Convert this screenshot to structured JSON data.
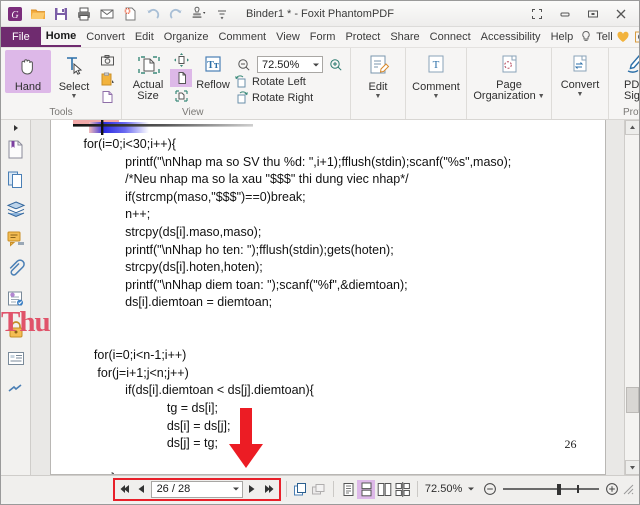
{
  "window": {
    "title": "Binder1 * - Foxit PhantomPDF",
    "quick_access": [
      {
        "name": "foxit-logo-icon",
        "label": "Foxit"
      },
      {
        "name": "open-folder-icon",
        "label": "Open"
      },
      {
        "name": "save-icon",
        "label": "Save"
      },
      {
        "name": "print-icon",
        "label": "Print"
      },
      {
        "name": "email-icon",
        "label": "Email"
      },
      {
        "name": "new-from-file-icon",
        "label": "Create PDF"
      },
      {
        "name": "undo-icon",
        "label": "Undo"
      },
      {
        "name": "redo-icon",
        "label": "Redo"
      },
      {
        "name": "stamp-icon",
        "label": "Stamp"
      },
      {
        "name": "customize-toolbar-icon",
        "label": "Customize"
      }
    ],
    "controls": [
      {
        "name": "fullscreen-button",
        "label": "Fullscreen"
      },
      {
        "name": "minimize-button",
        "label": "Minimize"
      },
      {
        "name": "restore-button",
        "label": "Restore"
      },
      {
        "name": "close-button",
        "label": "Close"
      }
    ]
  },
  "menubar": {
    "file": "File",
    "items": [
      {
        "label": "Home",
        "active": true
      },
      {
        "label": "Convert",
        "active": false
      },
      {
        "label": "Edit",
        "active": false
      },
      {
        "label": "Organize",
        "active": false
      },
      {
        "label": "Comment",
        "active": false
      },
      {
        "label": "View",
        "active": false
      },
      {
        "label": "Form",
        "active": false
      },
      {
        "label": "Protect",
        "active": false
      },
      {
        "label": "Share",
        "active": false
      },
      {
        "label": "Connect",
        "active": false
      },
      {
        "label": "Accessibility",
        "active": false
      },
      {
        "label": "Help",
        "active": false
      }
    ],
    "tell_label": "Tell",
    "find_label": "Fi"
  },
  "ribbon": {
    "groups": [
      {
        "label": "Tools",
        "buttons": [
          {
            "name": "hand-tool-button",
            "label": "Hand",
            "selected": true
          },
          {
            "name": "select-tool-button",
            "label": "Select",
            "selected": false
          }
        ],
        "small_icons": [
          {
            "name": "snapshot-icon",
            "label": "Snapshot"
          },
          {
            "name": "clipboard-icon",
            "label": "Clipboard"
          },
          {
            "name": "select-page-icon",
            "label": "Select Annotation"
          }
        ]
      },
      {
        "label": "View",
        "buttons": [
          {
            "name": "actual-size-button",
            "label": "Actual",
            "label2": "Size"
          },
          {
            "name": "fit-page-button",
            "label": "Fit Page"
          },
          {
            "name": "reflow-button",
            "label": "Reflow"
          }
        ],
        "zoom_value": "72.50%",
        "rotate_left": "Rotate Left",
        "rotate_right": "Rotate Right"
      }
    ],
    "command_buttons": [
      {
        "name": "edit-button",
        "label": "Edit",
        "has_caret": true
      },
      {
        "name": "comment-button",
        "label": "Comment",
        "has_caret": true
      },
      {
        "name": "page-organization-button",
        "label": "Page",
        "label2": "Organization",
        "has_caret": true
      },
      {
        "name": "convert-button",
        "label": "Convert",
        "has_caret": true
      },
      {
        "name": "pdf-sign-button",
        "label": "PDF",
        "label2": "Sign",
        "has_caret": false
      }
    ],
    "protect_label": "Protect",
    "collapse_label": "∧"
  },
  "navpane": {
    "items": [
      {
        "name": "sidebar-item-bookmarks",
        "label": "Bookmarks"
      },
      {
        "name": "sidebar-item-pages",
        "label": "Page Thumbnails"
      },
      {
        "name": "sidebar-item-layers",
        "label": "Layers"
      },
      {
        "name": "sidebar-item-comments",
        "label": "Comments"
      },
      {
        "name": "sidebar-item-attachments",
        "label": "Attachments"
      },
      {
        "name": "sidebar-item-signatures",
        "label": "Digital Signatures"
      },
      {
        "name": "sidebar-item-security",
        "label": "Security"
      },
      {
        "name": "sidebar-item-fields",
        "label": "Fields"
      },
      {
        "name": "sidebar-item-stamps",
        "label": "Stamps"
      }
    ]
  },
  "watermark": "Thu",
  "document": {
    "page_label": "26",
    "code": "for(i=0;i<30;i++){\n            printf(\"\\nNhap ma so SV thu %d: \",i+1);fflush(stdin);scanf(\"%s\",maso);\n            /*Neu nhap ma so la xau \"$$$\" thi dung viec nhap*/\n            if(strcmp(maso,\"$$$\")==0)break;\n            n++;\n            strcpy(ds[i].maso,maso);\n            printf(\"\\nNhap ho ten: \");fflush(stdin);gets(hoten);\n            strcpy(ds[i].hoten,hoten);\n            printf(\"\\nNhap diem toan: \");scanf(\"%f\",&diemtoan);\n            ds[i].diemtoan = diemtoan;\n\n\n   for(i=0;i<n-1;i++)\n    for(j=i+1;j<n;j++)\n            if(ds[i].diemtoan < ds[j].diemtoan){\n                        tg = ds[i];\n                        ds[i] = ds[j];\n                        ds[j] = tg;\n\n        }"
  },
  "statusbar": {
    "page_value": "26 / 28",
    "nav_buttons": [
      {
        "name": "first-page-button",
        "label": "First Page"
      },
      {
        "name": "previous-page-button",
        "label": "Previous Page"
      },
      {
        "name": "next-page-button",
        "label": "Next Page"
      },
      {
        "name": "last-page-button",
        "label": "Last Page"
      }
    ],
    "view_icons": [
      {
        "name": "single-page-view-icon",
        "label": "Single Page",
        "selected": false
      },
      {
        "name": "continuous-view-icon",
        "label": "Continuous",
        "selected": true
      },
      {
        "name": "facing-view-icon",
        "label": "Facing",
        "selected": false
      },
      {
        "name": "continuous-facing-view-icon",
        "label": "Continuous Facing",
        "selected": false
      }
    ],
    "split_icons": [
      {
        "name": "split-view-icon",
        "label": "Split"
      },
      {
        "name": "reading-mode-icon",
        "label": "Reading Mode"
      }
    ],
    "zoom_value": "72.50%",
    "zoom_out_label": "Zoom Out",
    "zoom_in_label": "Zoom In"
  },
  "colors": {
    "brand_purple": "#6f2b6f",
    "selection_purple": "#ddb8e8",
    "annotation_red": "#e8202a",
    "watermark_red": "#e0536a"
  }
}
